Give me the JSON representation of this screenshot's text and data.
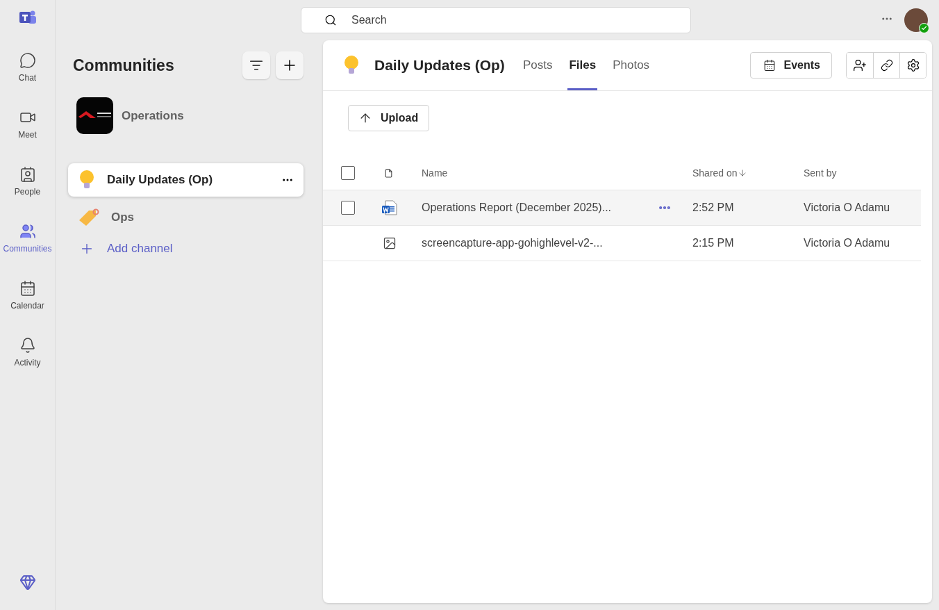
{
  "rail": [
    {
      "kind": "chat",
      "label": "Chat",
      "selected": false
    },
    {
      "kind": "meet",
      "label": "Meet",
      "selected": false
    },
    {
      "kind": "people",
      "label": "People",
      "selected": false
    },
    {
      "kind": "communities",
      "label": "Communities",
      "selected": true
    },
    {
      "kind": "calendar",
      "label": "Calendar",
      "selected": false
    },
    {
      "kind": "activity",
      "label": "Activity",
      "selected": false
    }
  ],
  "search": {
    "placeholder": "Search"
  },
  "sidebar": {
    "title": "Communities",
    "community": {
      "name": "Operations"
    },
    "channels": [
      {
        "kind": "bulb",
        "name": "Daily Updates (Op)",
        "selected": true
      },
      {
        "kind": "tag",
        "name": "Ops",
        "selected": false
      }
    ],
    "add_channel": "Add channel"
  },
  "channel": {
    "title": "Daily Updates (Op)",
    "tabs": [
      {
        "label": "Posts",
        "selected": false
      },
      {
        "label": "Files",
        "selected": true
      },
      {
        "label": "Photos",
        "selected": false
      }
    ],
    "events": "Events"
  },
  "upload": "Upload",
  "table": {
    "columns": [
      "Name",
      "Shared on",
      "Sent by"
    ],
    "select_all_checked": false,
    "rows": [
      {
        "kind": "word",
        "name": "Operations Report (December 2025)...",
        "shared_on": "2:52 PM",
        "sent_by": "Victoria O Adamu",
        "hovered": true,
        "checked": false
      },
      {
        "kind": "image",
        "name": "screencapture-app-gohighlevel-v2-...",
        "shared_on": "2:15 PM",
        "sent_by": "Victoria O Adamu",
        "hovered": false
      }
    ]
  }
}
